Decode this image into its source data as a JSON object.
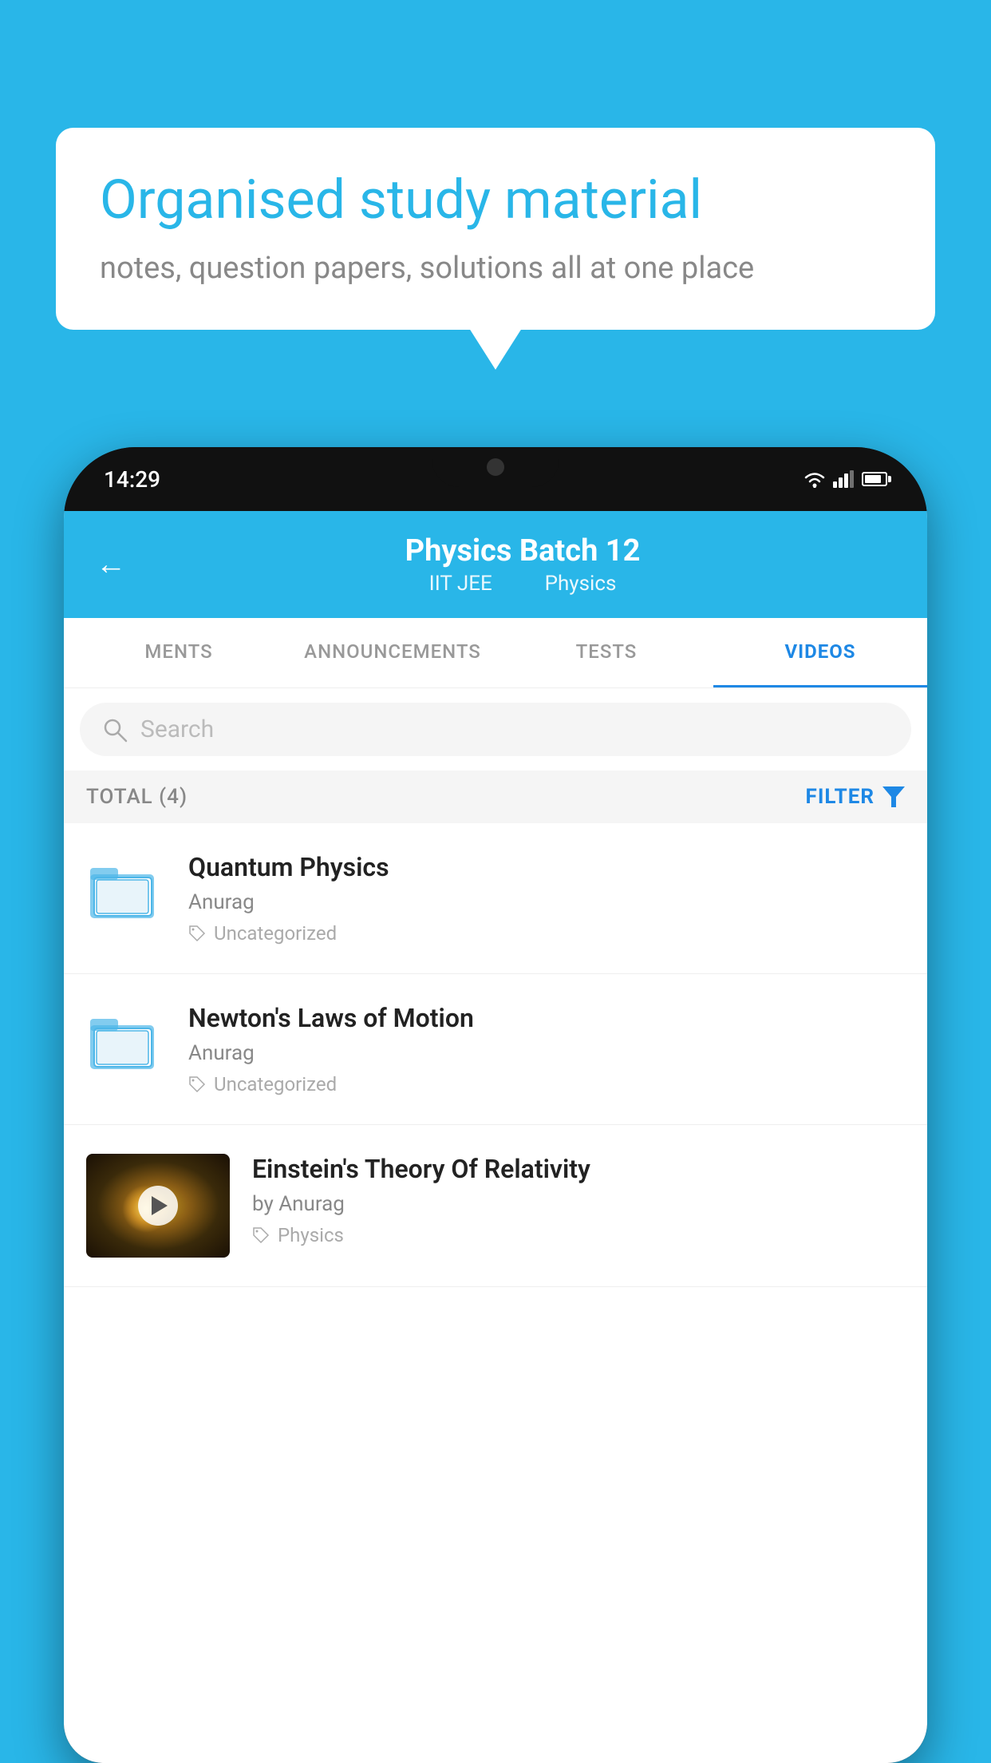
{
  "bubble": {
    "title": "Organised study material",
    "subtitle": "notes, question papers, solutions all at one place"
  },
  "status_bar": {
    "time": "14:29"
  },
  "header": {
    "title": "Physics Batch 12",
    "subtitle1": "IIT JEE",
    "subtitle2": "Physics"
  },
  "tabs": [
    {
      "label": "MENTS",
      "active": false
    },
    {
      "label": "ANNOUNCEMENTS",
      "active": false
    },
    {
      "label": "TESTS",
      "active": false
    },
    {
      "label": "VIDEOS",
      "active": true
    }
  ],
  "search": {
    "placeholder": "Search"
  },
  "filter": {
    "total_label": "TOTAL (4)",
    "filter_label": "FILTER"
  },
  "videos": [
    {
      "title": "Quantum Physics",
      "author": "Anurag",
      "tag": "Uncategorized",
      "has_thumb": false
    },
    {
      "title": "Newton's Laws of Motion",
      "author": "Anurag",
      "tag": "Uncategorized",
      "has_thumb": false
    },
    {
      "title": "Einstein's Theory Of Relativity",
      "author": "by Anurag",
      "tag": "Physics",
      "has_thumb": true
    }
  ]
}
